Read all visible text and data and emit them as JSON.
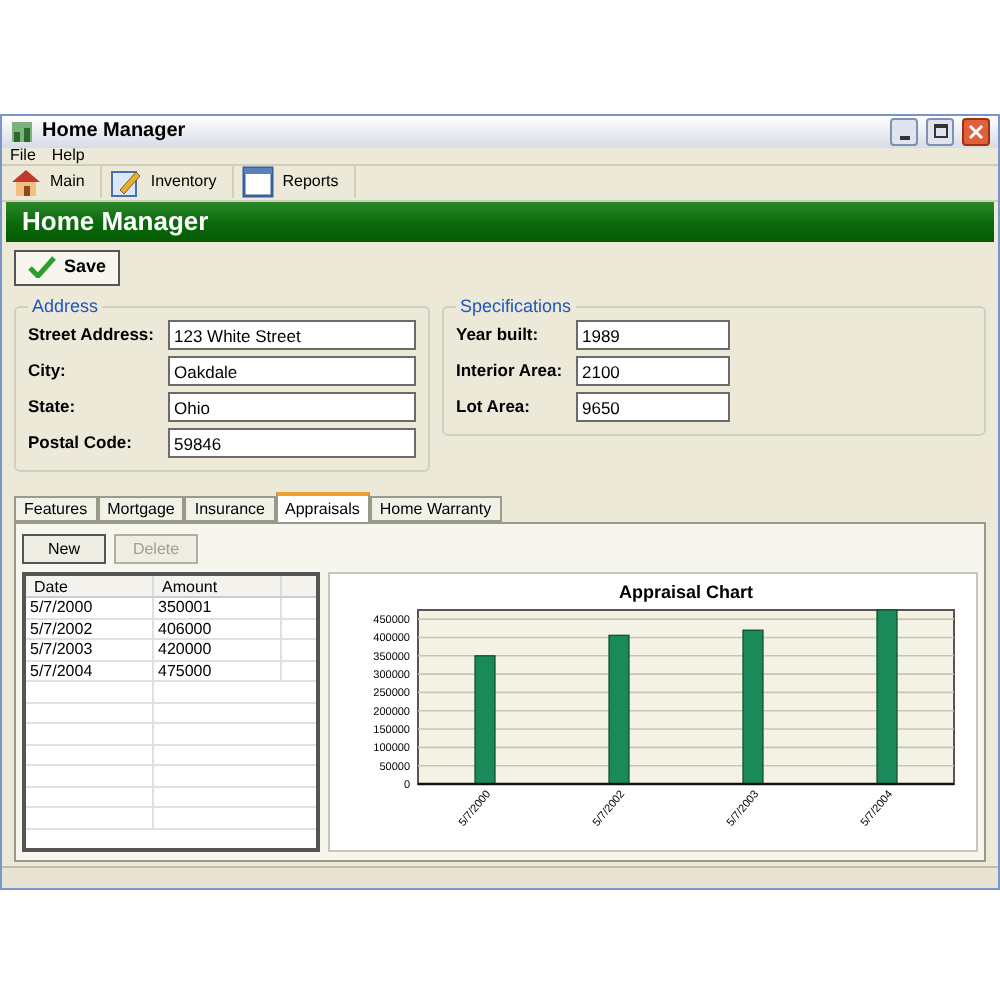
{
  "window": {
    "title": "Home Manager"
  },
  "menu": [
    "File",
    "Help"
  ],
  "toolbar": [
    {
      "label": "Main",
      "kind": "house"
    },
    {
      "label": "Inventory",
      "kind": "pencil"
    },
    {
      "label": "Reports",
      "kind": "report"
    }
  ],
  "header": "Home Manager",
  "save_button": "Save",
  "address": {
    "title": "Address",
    "fields": [
      {
        "label": "Street Address:",
        "value": "123 White Street"
      },
      {
        "label": "City:",
        "value": "Oakdale"
      },
      {
        "label": "State:",
        "value": "Ohio"
      },
      {
        "label": "Postal Code:",
        "value": "59846"
      }
    ]
  },
  "specifications": {
    "title": "Specifications",
    "fields": [
      {
        "label": "Year built:",
        "value": "1989"
      },
      {
        "label": "Interior Area:",
        "value": "2100"
      },
      {
        "label": "Lot Area:",
        "value": "9650"
      }
    ]
  },
  "tabs": [
    {
      "label": "Features",
      "selected": false
    },
    {
      "label": "Mortgage",
      "selected": false
    },
    {
      "label": "Insurance",
      "selected": false
    },
    {
      "label": "Appraisals",
      "selected": true
    },
    {
      "label": "Home Warranty",
      "selected": false
    }
  ],
  "buttons": [
    {
      "label": "New",
      "disabled": false
    },
    {
      "label": "Delete",
      "disabled": true
    }
  ],
  "table": {
    "columns": [
      "Date",
      "Amount"
    ],
    "rows": [
      [
        "5/7/2000",
        "350001"
      ],
      [
        "5/7/2002",
        "406000"
      ],
      [
        "5/7/2003",
        "420000"
      ],
      [
        "5/7/2004",
        "475000"
      ]
    ]
  },
  "chart_data": {
    "type": "bar",
    "title": "Appraisal Chart",
    "categories": [
      "5/7/2000",
      "5/7/2002",
      "5/7/2003",
      "5/7/2004"
    ],
    "values": [
      350000,
      406000,
      420000,
      475000
    ],
    "grid": true,
    "ylim": [
      0,
      475000
    ],
    "yticks": [
      0,
      50000,
      100000,
      150000,
      200000,
      250000,
      300000,
      350000,
      400000,
      450000
    ]
  }
}
